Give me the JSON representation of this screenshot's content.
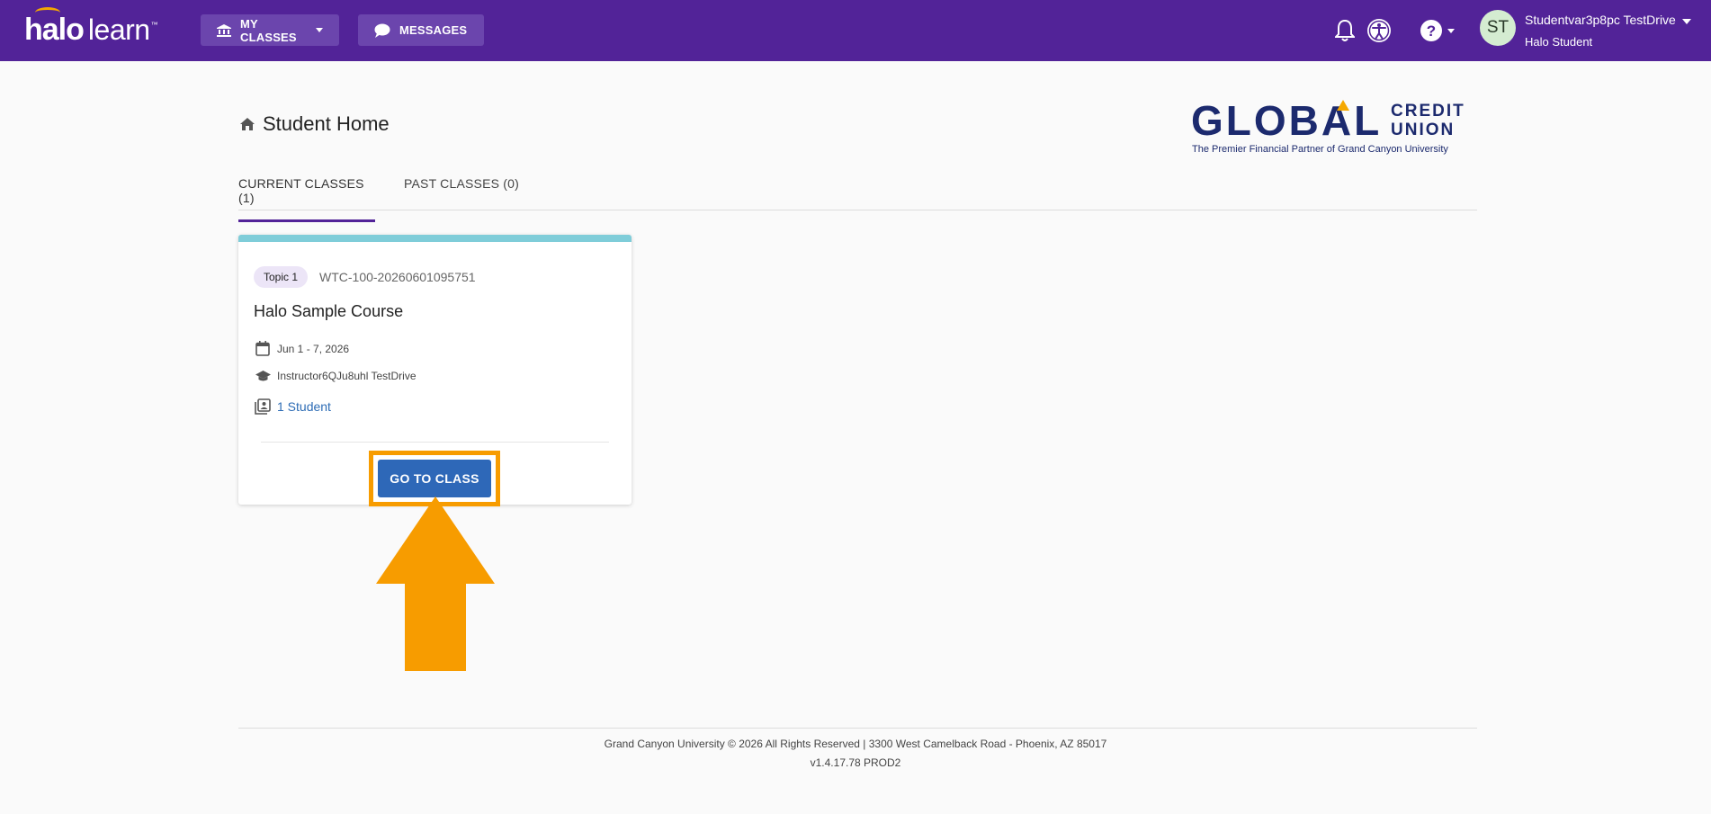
{
  "app": {
    "logo_main": "halo",
    "logo_sub": "learn",
    "logo_tm": "™"
  },
  "nav": {
    "my_classes": "MY CLASSES",
    "messages": "MESSAGES"
  },
  "user": {
    "initials": "ST",
    "name": "Studentvar3p8pc TestDrive",
    "role": "Halo Student"
  },
  "page": {
    "title": "Student Home"
  },
  "sponsor": {
    "name": "GLOBAL",
    "credit": "CREDIT",
    "union": "UNION",
    "tagline": "The Premier Financial Partner of Grand Canyon University"
  },
  "tabs": [
    {
      "label": "CURRENT CLASSES (1)",
      "active": true
    },
    {
      "label": "PAST CLASSES (0)",
      "active": false
    }
  ],
  "course": {
    "topic": "Topic 1",
    "code": "WTC-100-20260601095751",
    "title": "Halo Sample Course",
    "dates": "Jun 1 - 7, 2026",
    "instructor": "Instructor6QJu8uhl TestDrive",
    "students": "1 Student",
    "button": "GO TO CLASS",
    "accent_color": "#7fcdd9"
  },
  "footer": {
    "copyright": "Grand Canyon University © 2026 All Rights Reserved | 3300 West Camelback Road - Phoenix, AZ 85017",
    "version": "v1.4.17.78 PROD2"
  },
  "colors": {
    "brand": "#522398",
    "button": "#2e68b8",
    "annotation": "#f79c00"
  }
}
